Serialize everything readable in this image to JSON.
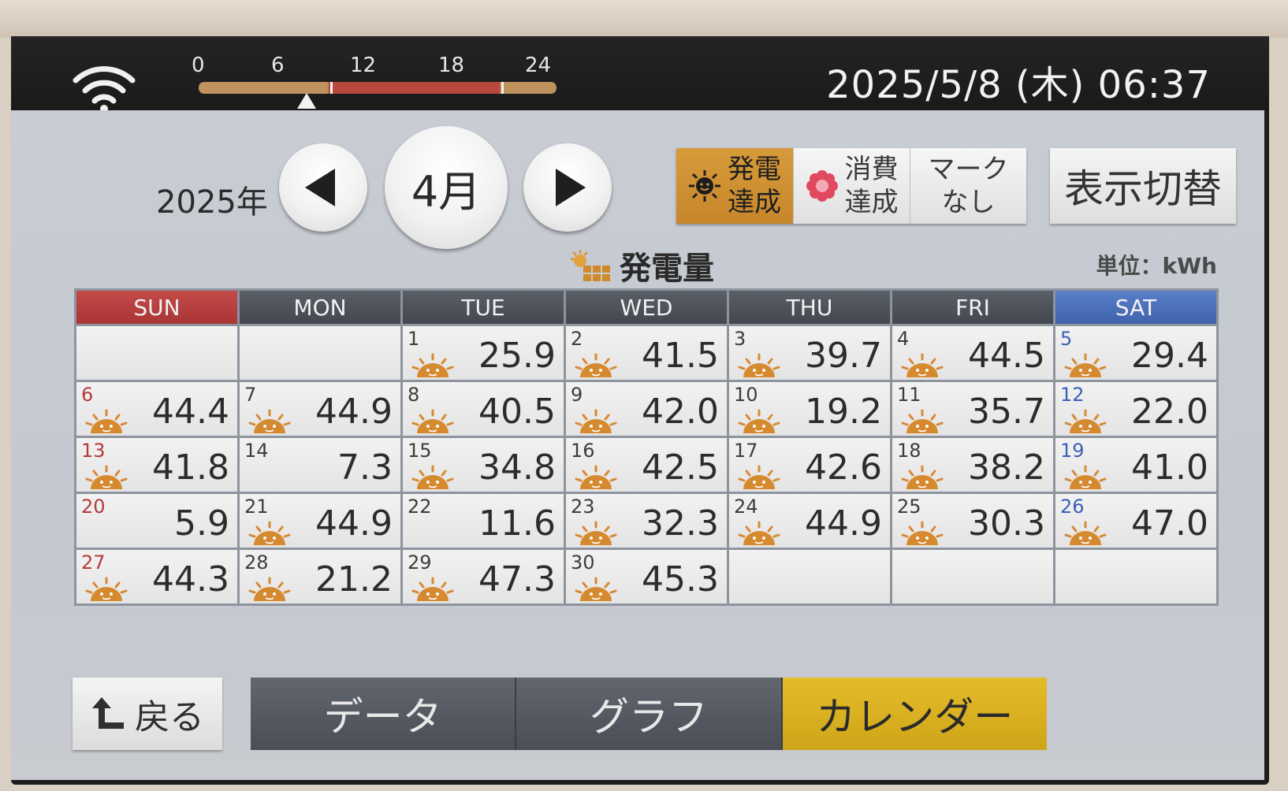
{
  "status": {
    "time_ticks": [
      "0",
      "6",
      "12",
      "18",
      "24"
    ],
    "current_hour_fraction": 0.27,
    "datetime": "2025/5/8 (木) 06:37"
  },
  "nav": {
    "year": "2025年",
    "month": "4月"
  },
  "marks": {
    "generation_achieved": "発電\n達成",
    "generation_line1": "発電",
    "generation_line2": "達成",
    "consumption_line1": "消費",
    "consumption_line2": "達成",
    "none_line1": "マーク",
    "none_line2": "なし"
  },
  "switch_label": "表示切替",
  "section": {
    "title": "発電量",
    "unit": "単位：kWh"
  },
  "calendar": {
    "weekdays": [
      "SUN",
      "MON",
      "TUE",
      "WED",
      "THU",
      "FRI",
      "SAT"
    ],
    "leading_blanks": 2,
    "trailing_blanks": 3,
    "days": [
      {
        "day": "1",
        "value": "25.9"
      },
      {
        "day": "2",
        "value": "41.5"
      },
      {
        "day": "3",
        "value": "39.7"
      },
      {
        "day": "4",
        "value": "44.5"
      },
      {
        "day": "5",
        "value": "29.4"
      },
      {
        "day": "6",
        "value": "44.4"
      },
      {
        "day": "7",
        "value": "44.9"
      },
      {
        "day": "8",
        "value": "40.5"
      },
      {
        "day": "9",
        "value": "42.0"
      },
      {
        "day": "10",
        "value": "19.2"
      },
      {
        "day": "11",
        "value": "35.7"
      },
      {
        "day": "12",
        "value": "22.0"
      },
      {
        "day": "13",
        "value": "41.8"
      },
      {
        "day": "14",
        "value": "7.3"
      },
      {
        "day": "15",
        "value": "34.8"
      },
      {
        "day": "16",
        "value": "42.5"
      },
      {
        "day": "17",
        "value": "42.6"
      },
      {
        "day": "18",
        "value": "38.2"
      },
      {
        "day": "19",
        "value": "41.0"
      },
      {
        "day": "20",
        "value": "5.9"
      },
      {
        "day": "21",
        "value": "44.9"
      },
      {
        "day": "22",
        "value": "11.6"
      },
      {
        "day": "23",
        "value": "32.3"
      },
      {
        "day": "24",
        "value": "44.9"
      },
      {
        "day": "25",
        "value": "30.3"
      },
      {
        "day": "26",
        "value": "47.0"
      },
      {
        "day": "27",
        "value": "44.3"
      },
      {
        "day": "28",
        "value": "21.2"
      },
      {
        "day": "29",
        "value": "47.3"
      },
      {
        "day": "30",
        "value": "45.3"
      }
    ],
    "no_mark_days": [
      "14",
      "20",
      "22"
    ]
  },
  "bottom": {
    "back_label": "戻る",
    "tabs": [
      "データ",
      "グラフ",
      "カレンダー"
    ],
    "active_tab": 2
  },
  "colors": {
    "generation_mark": "#c7862a",
    "sun_header": "#a93535",
    "sat_header": "#3f62ad",
    "active_tab": "#cfa519"
  }
}
